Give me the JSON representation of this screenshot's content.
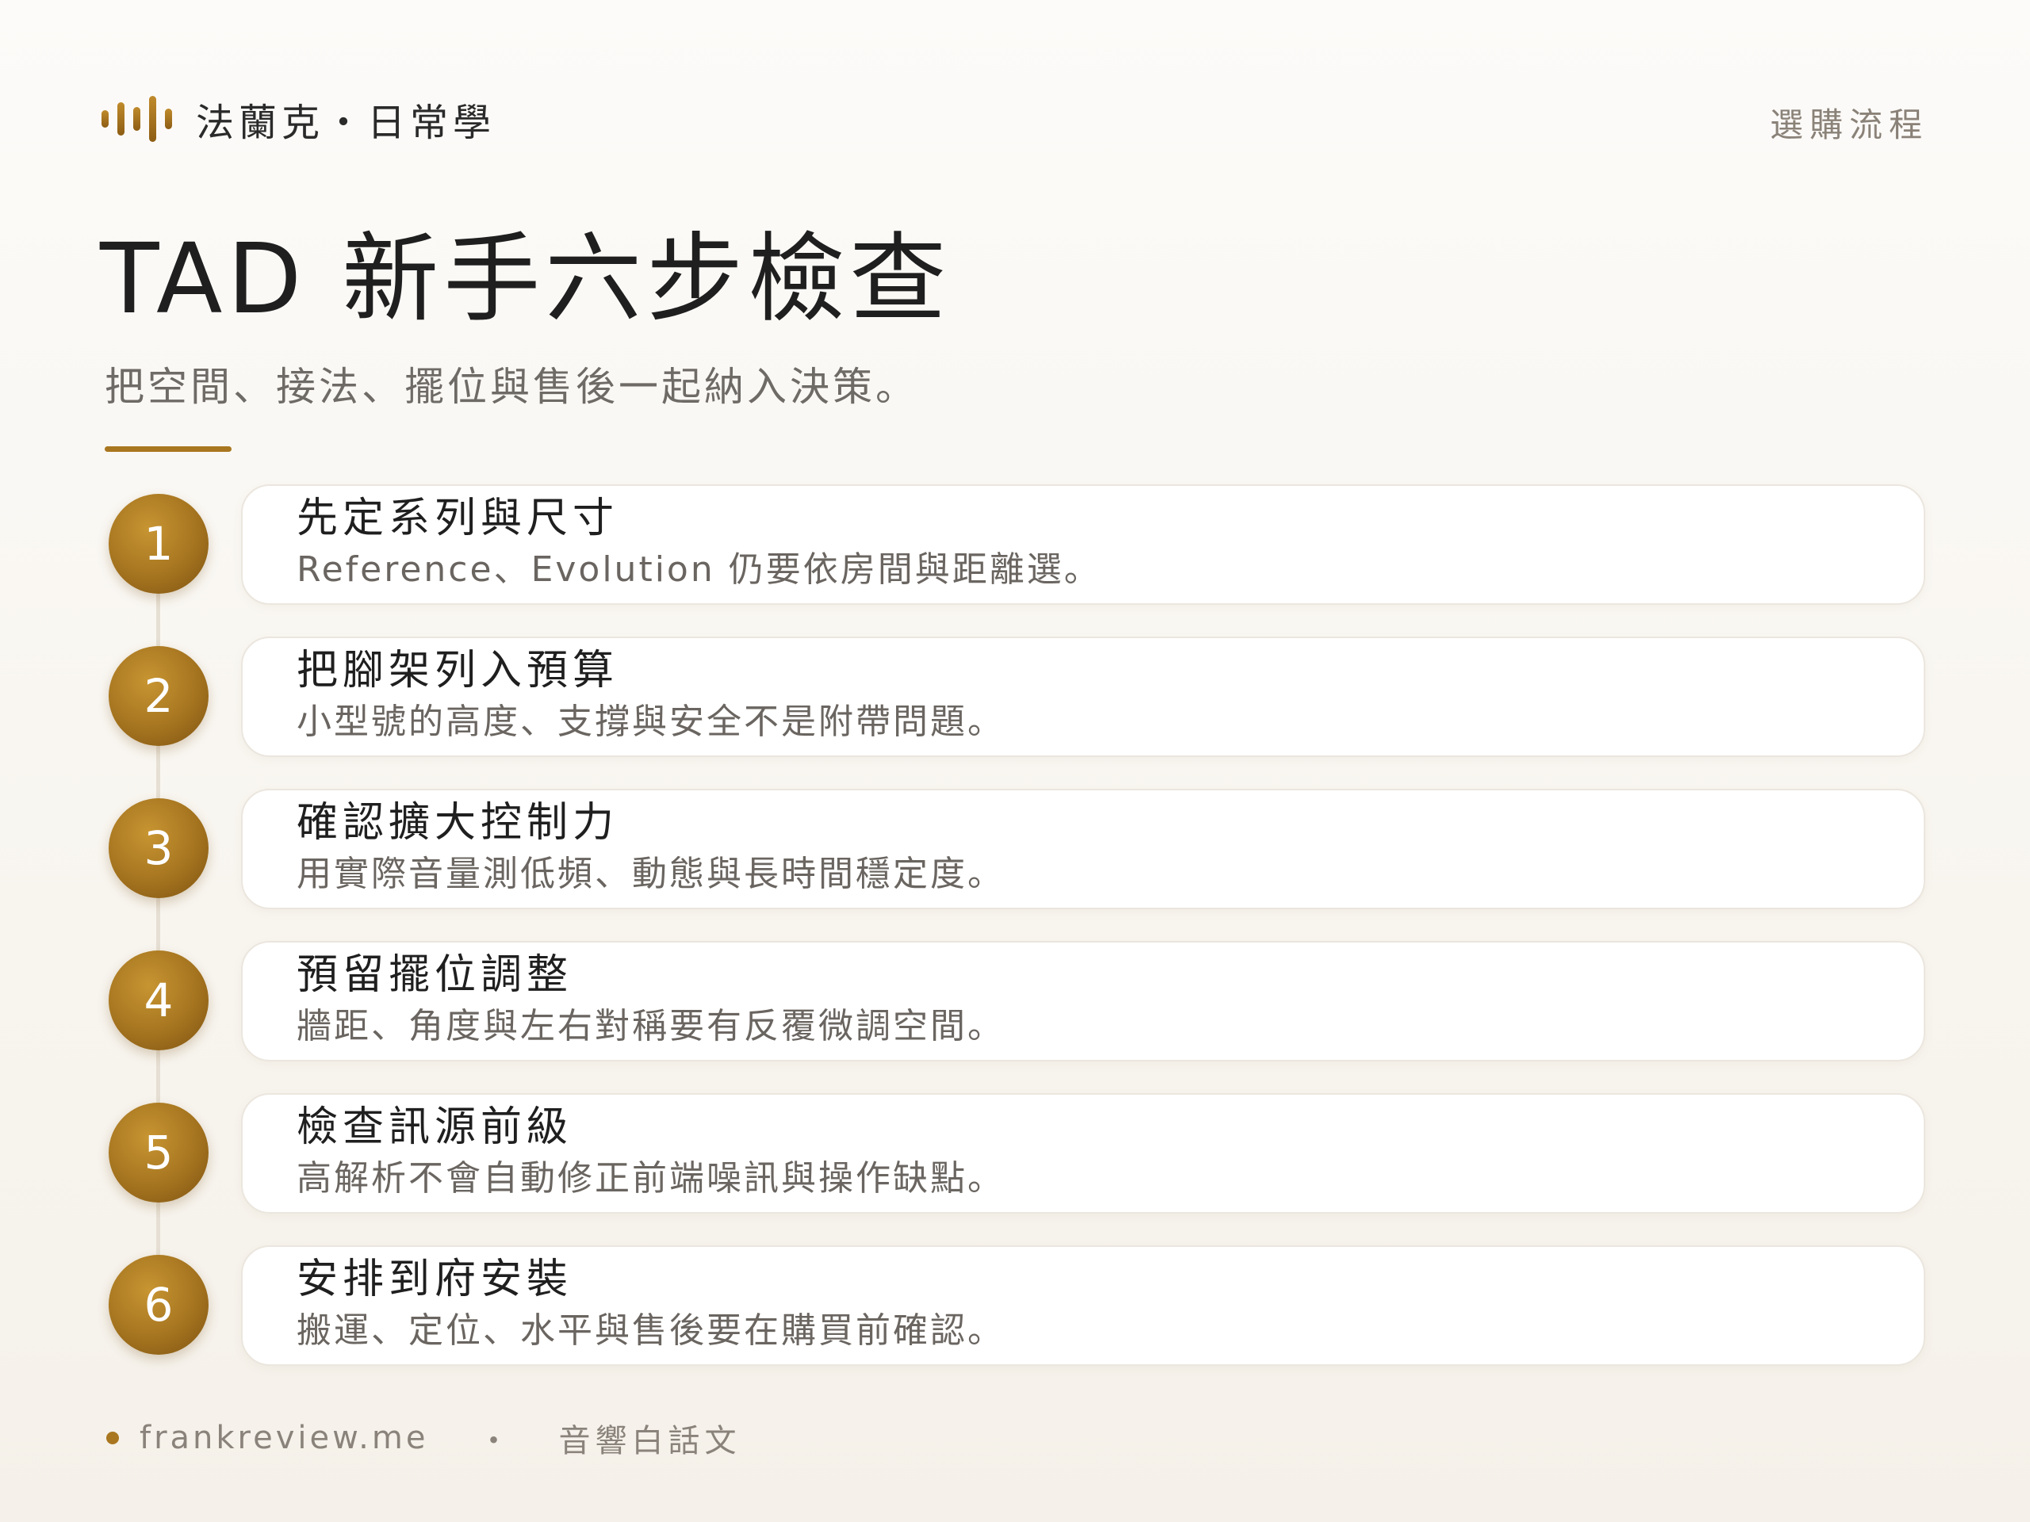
{
  "brand": {
    "name": "法蘭克・日常學",
    "icon": "sound-wave-icon",
    "accent_color": "#a97720"
  },
  "header": {
    "section_tag": "選購流程"
  },
  "main": {
    "title": "TAD 新手六步檢查",
    "subtitle": "把空間、接法、擺位與售後一起納入決策。"
  },
  "steps": [
    {
      "number": "1",
      "title": "先定系列與尺寸",
      "description": "Reference、Evolution 仍要依房間與距離選。"
    },
    {
      "number": "2",
      "title": "把腳架列入預算",
      "description": "小型號的高度、支撐與安全不是附帶問題。"
    },
    {
      "number": "3",
      "title": "確認擴大控制力",
      "description": "用實際音量測低頻、動態與長時間穩定度。"
    },
    {
      "number": "4",
      "title": "預留擺位調整",
      "description": "牆距、角度與左右對稱要有反覆微調空間。"
    },
    {
      "number": "5",
      "title": "檢查訊源前級",
      "description": "高解析不會自動修正前端噪訊與操作缺點。"
    },
    {
      "number": "6",
      "title": "安排到府安裝",
      "description": "搬運、定位、水平與售後要在購買前確認。"
    }
  ],
  "footer": {
    "site": "frankreview.me",
    "separator": "・",
    "slogan": "音響白話文"
  }
}
